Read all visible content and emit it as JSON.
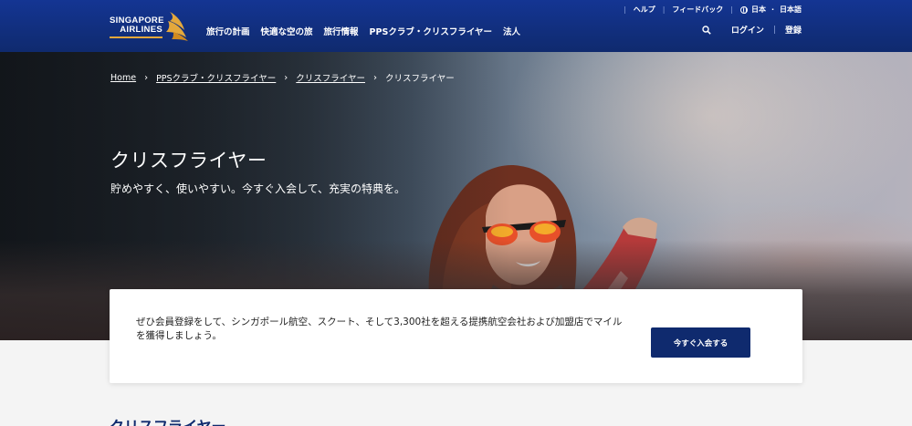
{
  "header": {
    "logo": {
      "line1": "SINGAPORE",
      "line2": "AIRLINES"
    },
    "main_nav": [
      {
        "label": "旅行の計画"
      },
      {
        "label": "快適な空の旅"
      },
      {
        "label": "旅行情報"
      },
      {
        "label": "PPSクラブ・クリスフライヤー"
      },
      {
        "label": "法人"
      }
    ],
    "util_nav": {
      "help": "ヘルプ",
      "feedback": "フィードバック",
      "region": "日本",
      "language": "日本語"
    },
    "account": {
      "login": "ログイン",
      "register": "登録"
    }
  },
  "hero": {
    "breadcrumb": [
      {
        "label": "Home"
      },
      {
        "label": "PPSクラブ・クリスフライヤー"
      },
      {
        "label": "クリスフライヤー"
      },
      {
        "label": "クリスフライヤー"
      }
    ],
    "title": "クリスフライヤー",
    "subtitle": "貯めやすく、使いやすい。今すぐ入会して、充実の特典を。"
  },
  "promo_card": {
    "text": "ぜひ会員登録をして、シンガポール航空、スクート、そして3,300社を超える提携航空会社および加盟店でマイルを獲得しましょう。",
    "button": "今すぐ入会する"
  },
  "section_peek": {
    "title": "クリスフライヤー"
  },
  "colors": {
    "brand_navy": "#0f2a6e",
    "accent_gold": "#e4a83c"
  }
}
